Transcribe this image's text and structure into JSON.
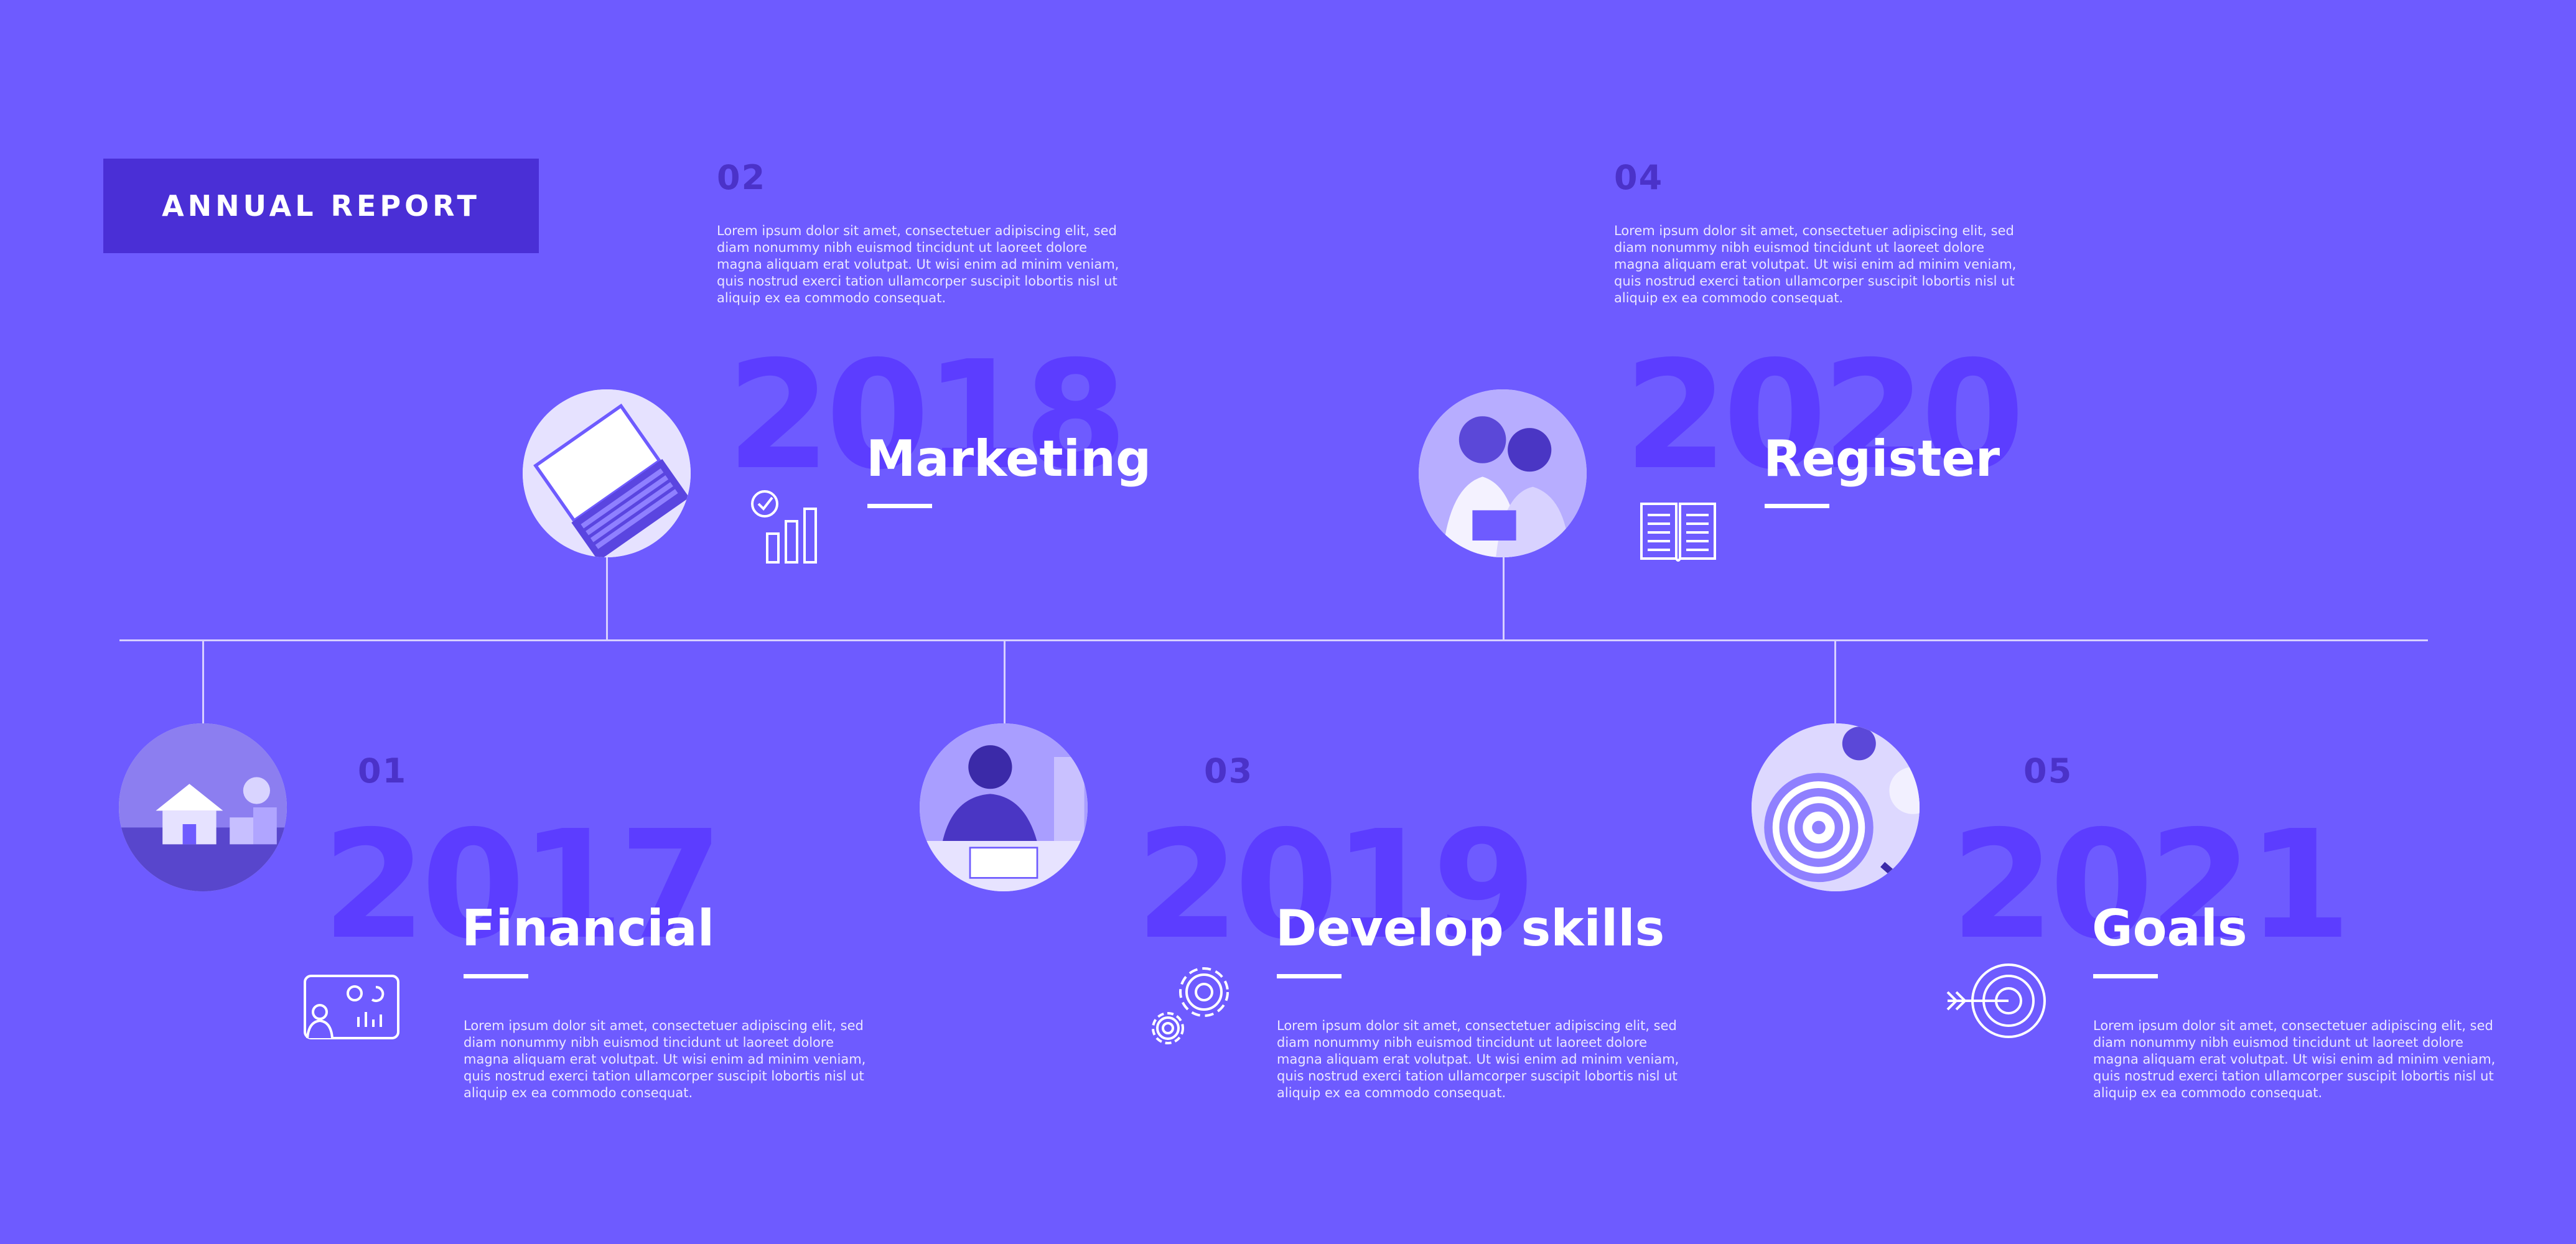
{
  "header": {
    "badge_label": "ANNUAL REPORT"
  },
  "milestones": [
    {
      "number": "01",
      "year": "2017",
      "title": "Financial",
      "icon": "finance-dashboard-icon",
      "photo": "house-coins-photo",
      "text": "Lorem ipsum dolor sit amet, consectetuer adipiscing elit, sed diam nonummy nibh euismod tincidunt ut laoreet dolore magna aliquam erat volutpat. Ut wisi enim ad minim veniam, quis nostrud exerci tation ullamcorper suscipit lobortis nisl ut aliquip ex ea commodo consequat."
    },
    {
      "number": "02",
      "year": "2018",
      "title": "Marketing",
      "icon": "growth-chart-icon",
      "photo": "laptop-photo",
      "text": "Lorem ipsum dolor sit amet, consectetuer adipiscing elit, sed diam nonummy nibh euismod tincidunt ut laoreet dolore magna aliquam erat volutpat. Ut wisi enim ad minim veniam, quis nostrud exerci tation ullamcorper suscipit lobortis nisl ut aliquip ex ea commodo consequat."
    },
    {
      "number": "03",
      "year": "2019",
      "title": "Develop skills",
      "icon": "gears-icon",
      "photo": "man-studying-photo",
      "text": "Lorem ipsum dolor sit amet, consectetuer adipiscing elit, sed diam nonummy nibh euismod tincidunt ut laoreet dolore magna aliquam erat volutpat. Ut wisi enim ad minim veniam, quis nostrud exerci tation ullamcorper suscipit lobortis nisl ut aliquip ex ea commodo consequat."
    },
    {
      "number": "04",
      "year": "2020",
      "title": "Register",
      "icon": "open-book-icon",
      "photo": "two-women-tablet-photo",
      "text": "Lorem ipsum dolor sit amet, consectetuer adipiscing elit, sed diam nonummy nibh euismod tincidunt ut laoreet dolore magna aliquam erat volutpat. Ut wisi enim ad minim veniam, quis nostrud exerci tation ullamcorper suscipit lobortis nisl ut aliquip ex ea commodo consequat."
    },
    {
      "number": "05",
      "year": "2021",
      "title": "Goals",
      "icon": "target-arrow-icon",
      "photo": "dartboard-photo",
      "text": "Lorem ipsum dolor sit amet, consectetuer adipiscing elit, sed diam nonummy nibh euismod tincidunt ut laoreet dolore magna aliquam erat volutpat. Ut wisi enim ad minim veniam, quis nostrud exerci tation ullamcorper suscipit lobortis nisl ut aliquip ex ea commodo consequat."
    }
  ],
  "colors": {
    "background": "#6e5bff",
    "badge": "#4a2fd6",
    "year_watermark": "#5c3dff",
    "number": "#4b32c9",
    "line": "#d7d0ff"
  }
}
